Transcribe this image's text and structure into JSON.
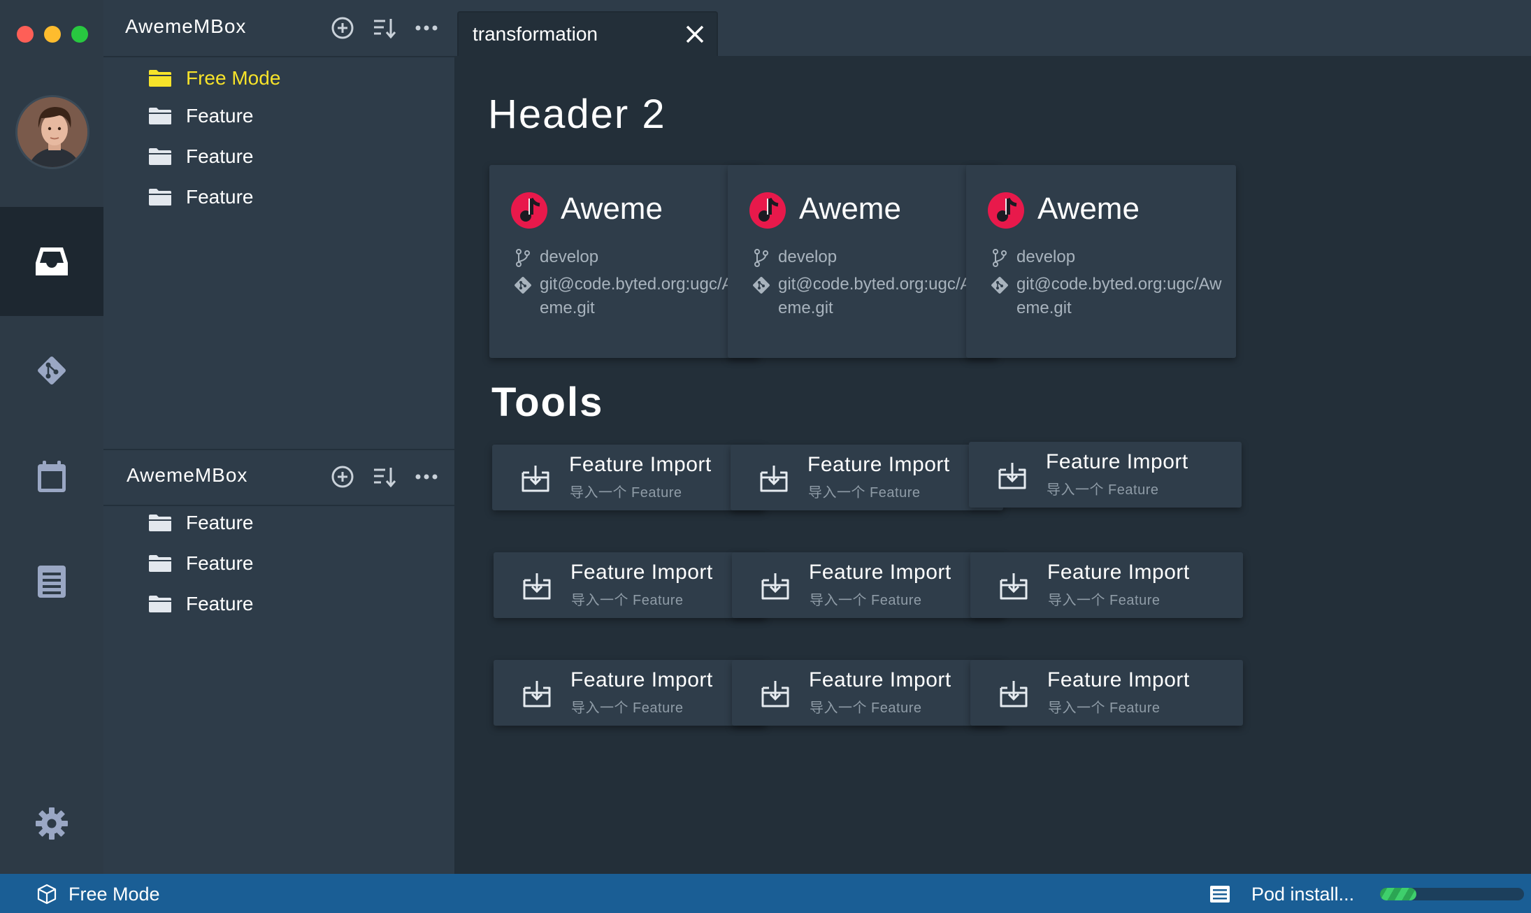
{
  "window": {
    "colors": {
      "accent_yellow": "#f7e32a",
      "status_blue": "#1a5e95",
      "music_red": "#e8194b"
    }
  },
  "rail": {
    "items": [
      {
        "icon": "inbox-icon",
        "active": true
      },
      {
        "icon": "git-icon",
        "active": false
      },
      {
        "icon": "calendar-icon",
        "active": false
      },
      {
        "icon": "document-icon",
        "active": false
      }
    ],
    "settings_icon": "gear-icon"
  },
  "sidebar": {
    "sections": [
      {
        "title": "AwemeMBox",
        "items": [
          {
            "label": "Free Mode",
            "active": true
          },
          {
            "label": "Feature"
          },
          {
            "label": "Feature"
          },
          {
            "label": "Feature"
          }
        ]
      },
      {
        "title": "AwemeMBox",
        "items": [
          {
            "label": "Feature"
          },
          {
            "label": "Feature"
          },
          {
            "label": "Feature"
          }
        ]
      }
    ]
  },
  "tabs": [
    {
      "label": "transformation"
    }
  ],
  "main": {
    "header": "Header 2",
    "repos": [
      {
        "name": "Aweme",
        "branch": "develop",
        "repo": "git@code.byted.org:ugc/Aweme.git"
      },
      {
        "name": "Aweme",
        "branch": "develop",
        "repo": "git@code.byted.org:ugc/Aweme.git"
      },
      {
        "name": "Aweme",
        "branch": "develop",
        "repo": "git@code.byted.org:ugc/Aweme.git"
      }
    ],
    "tools_title": "Tools",
    "tools": [
      {
        "title": "Feature Import",
        "subtitle": "导入一个 Feature"
      },
      {
        "title": "Feature Import",
        "subtitle": "导入一个 Feature"
      },
      {
        "title": "Feature Import",
        "subtitle": "导入一个 Feature"
      },
      {
        "title": "Feature Import",
        "subtitle": "导入一个 Feature"
      },
      {
        "title": "Feature Import",
        "subtitle": "导入一个 Feature"
      },
      {
        "title": "Feature Import",
        "subtitle": "导入一个 Feature"
      },
      {
        "title": "Feature Import",
        "subtitle": "导入一个 Feature"
      },
      {
        "title": "Feature Import",
        "subtitle": "导入一个 Feature"
      },
      {
        "title": "Feature Import",
        "subtitle": "导入一个 Feature"
      }
    ]
  },
  "status": {
    "mode": "Free Mode",
    "task": "Pod install...",
    "progress": 0.25
  }
}
